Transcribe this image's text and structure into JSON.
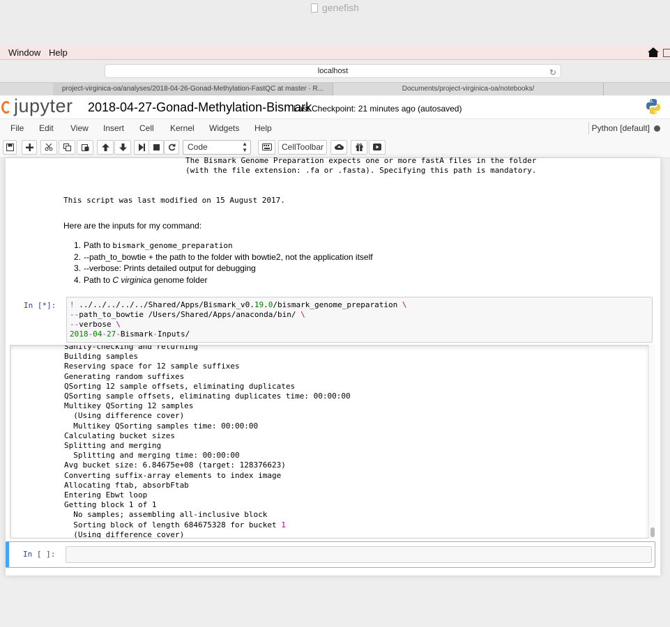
{
  "window": {
    "title": "genefish"
  },
  "mac_menu": {
    "items": [
      "Window",
      "Help"
    ]
  },
  "browser": {
    "url": "localhost",
    "tabs": [
      "project-virginica-oa/analyses/2018-04-26-Gonad-Methylation-FastQC at master · R...",
      "Documents/project-virginica-oa/notebooks/"
    ]
  },
  "jupyter": {
    "logo_text": "jupyter",
    "notebook_name": "2018-04-27-Gonad-Methylation-Bismark",
    "checkpoint": "Last Checkpoint: 21 minutes ago (autosaved)",
    "menu": [
      "File",
      "Edit",
      "View",
      "Insert",
      "Cell",
      "Kernel",
      "Widgets",
      "Help"
    ],
    "kernel": "Python [default]",
    "toolbar": {
      "cell_type": "Code",
      "celltoolbar_label": "CellToolbar"
    }
  },
  "notebook": {
    "md_pre_lines": [
      "The Bismark Genome Preparation expects one or more fastA files in the folder",
      "(with the file extension: .fa or .fasta). Specifying this path is mandatory."
    ],
    "md_modified": "This script was last modified on 15 August 2017.",
    "md_inputs_intro": "Here are the inputs for my command:",
    "md_inputs": [
      {
        "num": "1.",
        "text_before": "Path to ",
        "code": "bismark_genome_preparation",
        "text_after": ""
      },
      {
        "num": "2.",
        "text_before": "--path_to_bowtie + the path to the folder with bowtie2, not the application itself",
        "code": "",
        "text_after": ""
      },
      {
        "num": "3.",
        "text_before": "--verbose: Prints detailed output for debugging",
        "code": "",
        "text_after": ""
      },
      {
        "num": "4.",
        "text_before": "Path to ",
        "italic": "C virginica",
        "text_after": " genome folder"
      }
    ],
    "code_cell": {
      "prompt": "In [*]:",
      "line1": {
        "bang": "!",
        "path_a": " ../../../../../Shared/Apps/Bismark_v0.",
        "num_a": "19",
        "dot": ".",
        "num_b": "0",
        "path_b": "/bismark_genome_preparation ",
        "cont": "\\"
      },
      "line2": {
        "dash": "--",
        "text": "path_to_bowtie /Users/Shared/Apps/anaconda/bin/ ",
        "cont": "\\"
      },
      "line3": {
        "dash": "--",
        "text": "verbose ",
        "cont": "\\"
      },
      "line4": {
        "n1": "2018",
        "d1": "-",
        "n2": "04",
        "d2": "-",
        "n3": "27",
        "d3": "-",
        "text": "Bismark",
        "d4": "-",
        "text2": "Inputs/"
      }
    },
    "output_lines": [
      "Sanity-checking and returning",
      "Building samples",
      "Reserving space for 12 sample suffixes",
      "Generating random suffixes",
      "QSorting 12 sample offsets, eliminating duplicates",
      "QSorting sample offsets, eliminating duplicates time: 00:00:00",
      "Multikey QSorting 12 samples",
      "  (Using difference cover)",
      "  Multikey QSorting samples time: 00:00:00",
      "Calculating bucket sizes",
      "Splitting and merging",
      "  Splitting and merging time: 00:00:00",
      "Avg bucket size: 6.84675e+08 (target: 128376623)",
      "Converting suffix-array elements to index image",
      "Allocating ftab, absorbFtab",
      "Entering Ebwt loop",
      "Getting block 1 of 1",
      "  No samples; assembling all-inclusive block",
      "  Sorting block of length 684675328 for bucket ",
      "  (Using difference cover)"
    ],
    "output_bucket_num": "1",
    "empty_cell_prompt": "In [ ]:"
  }
}
